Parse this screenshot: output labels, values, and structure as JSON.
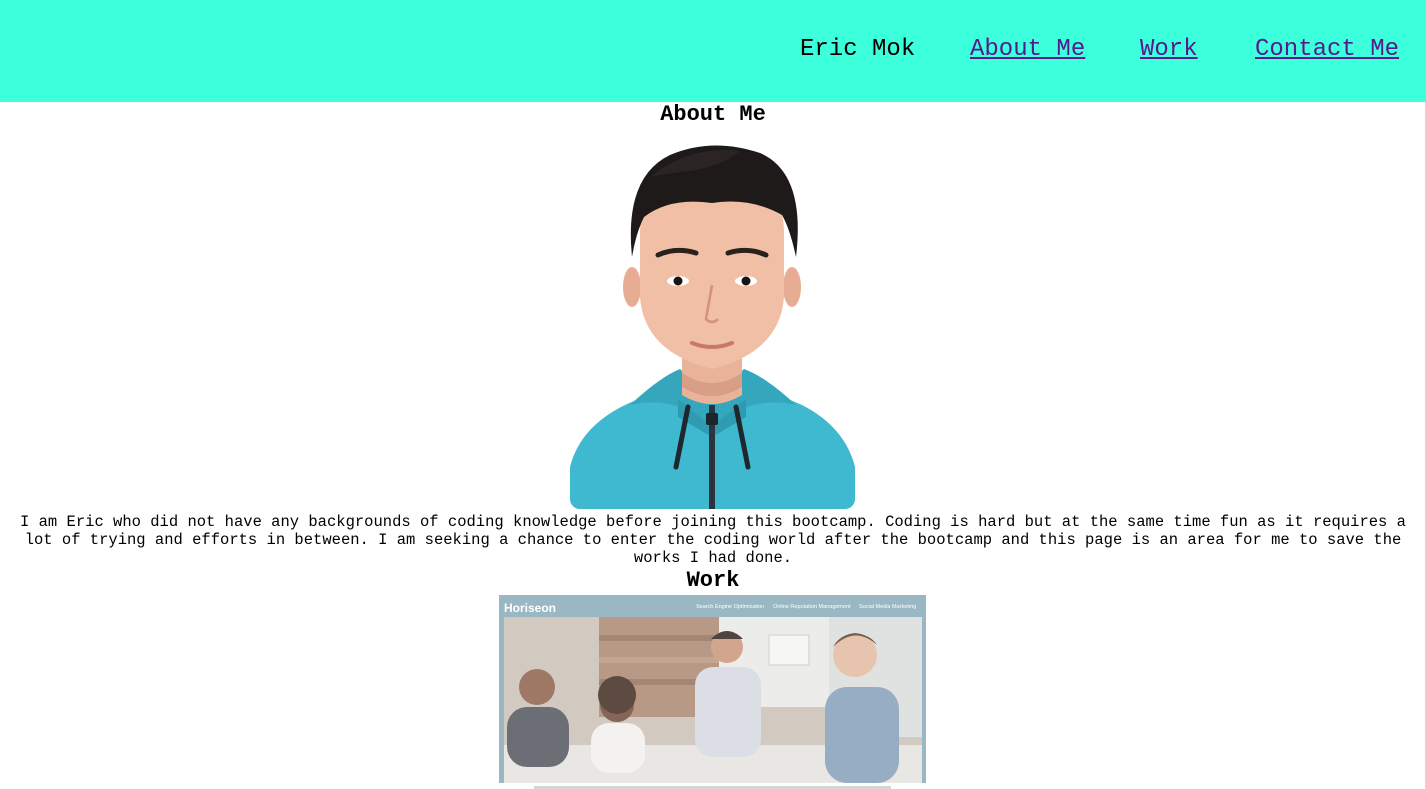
{
  "header": {
    "brand": "Eric Mok",
    "nav": [
      {
        "label": "About Me"
      },
      {
        "label": "Work"
      },
      {
        "label": "Contact Me"
      }
    ],
    "background_color": "#3cffdc",
    "link_color": "#551a8b"
  },
  "about": {
    "title": "About Me",
    "bio": "I am Eric who did not have any backgrounds of coding knowledge before joining this bootcamp. Coding is hard but at the same time fun as it requires a lot of trying and efforts in between. I am seeking a chance to enter the coding world after the bootcamp and this page is an area for me to save the works I had done."
  },
  "work": {
    "title": "Work",
    "screenshot": {
      "brand": "Horiseon",
      "nav": [
        "Search Engine Optimization",
        "Online Reputation Management",
        "Social Media Marketing"
      ]
    }
  }
}
